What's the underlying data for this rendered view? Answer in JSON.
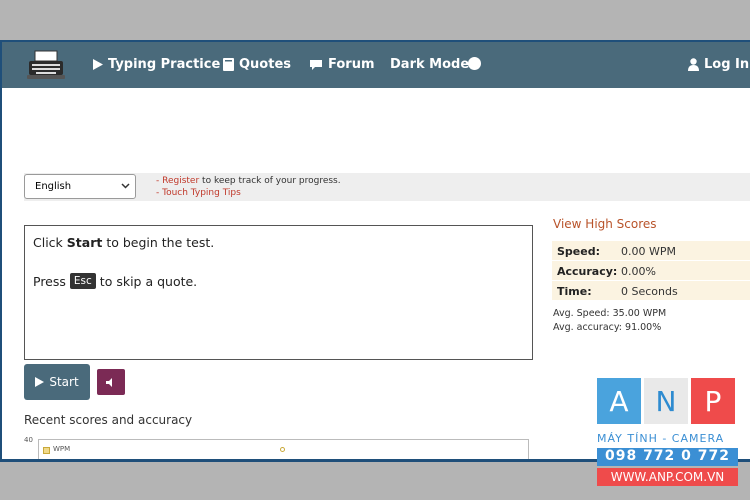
{
  "nav": {
    "items": [
      {
        "label": "Typing Practice"
      },
      {
        "label": "Quotes"
      },
      {
        "label": "Forum"
      },
      {
        "label": "Dark Mode"
      }
    ],
    "login": "Log In /"
  },
  "settings": {
    "language": "English",
    "register_link": "Register",
    "register_text": "to keep track of your progress.",
    "tips_link": "Touch Typing Tips"
  },
  "test": {
    "line1_pre": "Click",
    "line1_bold": "Start",
    "line1_post": "to begin the test.",
    "line2_pre": "Press",
    "line2_key": "Esc",
    "line2_post": "to skip a quote."
  },
  "controls": {
    "start_label": "Start"
  },
  "recent": {
    "title": "Recent scores and accuracy",
    "y_tick": "40",
    "legend": "WPM",
    "point_label": "0"
  },
  "scores": {
    "high_scores_link": "View High Scores",
    "rows": [
      {
        "key": "Speed:",
        "value": "0.00 WPM"
      },
      {
        "key": "Accuracy:",
        "value": "0.00%"
      },
      {
        "key": "Time:",
        "value": "0 Seconds"
      }
    ],
    "avg_speed": "Avg. Speed: 35.00 WPM",
    "avg_accuracy": "Avg. accuracy: 91.00%"
  },
  "watermark": {
    "letters": [
      "A",
      "N",
      "P"
    ],
    "tagline": "MÁY TÍNH - CAMERA",
    "phone": "098 772 0 772",
    "site": "WWW.ANP.COM.VN"
  }
}
